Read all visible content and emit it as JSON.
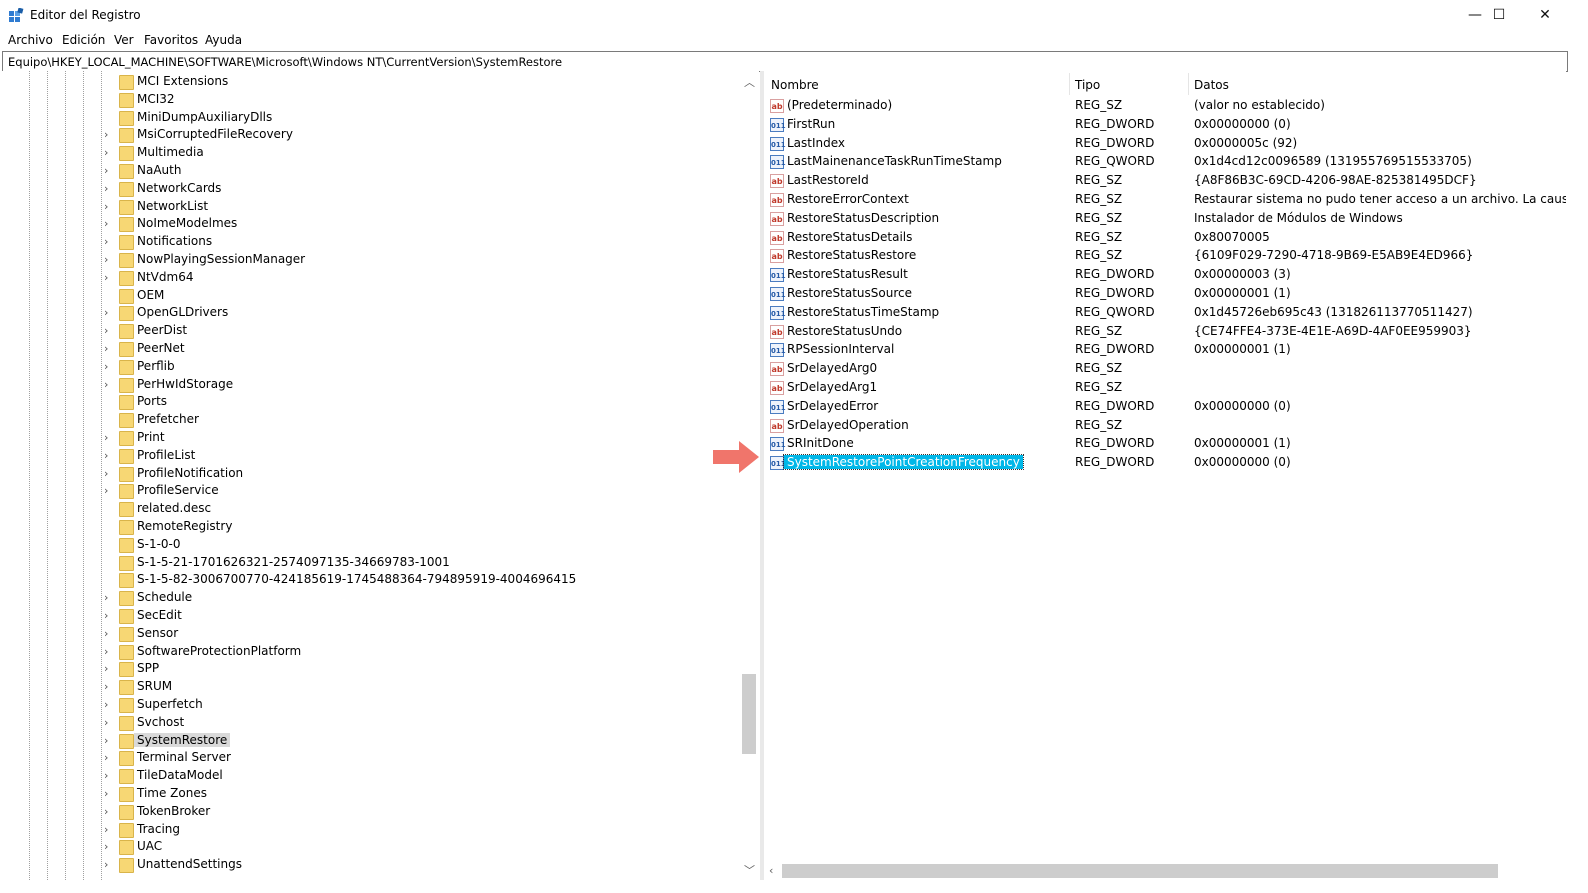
{
  "window": {
    "title": "Editor del Registro",
    "minimize": "—",
    "maximize": "☐",
    "close": "✕"
  },
  "menu": [
    "Archivo",
    "Edición",
    "Ver",
    "Favoritos",
    "Ayuda"
  ],
  "address": "Equipo\\HKEY_LOCAL_MACHINE\\SOFTWARE\\Microsoft\\Windows NT\\CurrentVersion\\SystemRestore",
  "tree": {
    "items": [
      {
        "label": "MCI Extensions",
        "expandable": false
      },
      {
        "label": "MCI32",
        "expandable": false
      },
      {
        "label": "MiniDumpAuxiliaryDlls",
        "expandable": false
      },
      {
        "label": "MsiCorruptedFileRecovery",
        "expandable": true
      },
      {
        "label": "Multimedia",
        "expandable": true
      },
      {
        "label": "NaAuth",
        "expandable": true
      },
      {
        "label": "NetworkCards",
        "expandable": true
      },
      {
        "label": "NetworkList",
        "expandable": true
      },
      {
        "label": "NoImeModelmes",
        "expandable": true
      },
      {
        "label": "Notifications",
        "expandable": true
      },
      {
        "label": "NowPlayingSessionManager",
        "expandable": true
      },
      {
        "label": "NtVdm64",
        "expandable": true
      },
      {
        "label": "OEM",
        "expandable": false
      },
      {
        "label": "OpenGLDrivers",
        "expandable": true
      },
      {
        "label": "PeerDist",
        "expandable": true
      },
      {
        "label": "PeerNet",
        "expandable": true
      },
      {
        "label": "Perflib",
        "expandable": true
      },
      {
        "label": "PerHwIdStorage",
        "expandable": true
      },
      {
        "label": "Ports",
        "expandable": false
      },
      {
        "label": "Prefetcher",
        "expandable": false
      },
      {
        "label": "Print",
        "expandable": true
      },
      {
        "label": "ProfileList",
        "expandable": true
      },
      {
        "label": "ProfileNotification",
        "expandable": true
      },
      {
        "label": "ProfileService",
        "expandable": true
      },
      {
        "label": "related.desc",
        "expandable": false
      },
      {
        "label": "RemoteRegistry",
        "expandable": false
      },
      {
        "label": "S-1-0-0",
        "expandable": false
      },
      {
        "label": "S-1-5-21-1701626321-2574097135-34669783-1001",
        "expandable": false
      },
      {
        "label": "S-1-5-82-3006700770-424185619-1745488364-794895919-4004696415",
        "expandable": false
      },
      {
        "label": "Schedule",
        "expandable": true
      },
      {
        "label": "SecEdit",
        "expandable": true
      },
      {
        "label": "Sensor",
        "expandable": true
      },
      {
        "label": "SoftwareProtectionPlatform",
        "expandable": true
      },
      {
        "label": "SPP",
        "expandable": true
      },
      {
        "label": "SRUM",
        "expandable": true
      },
      {
        "label": "Superfetch",
        "expandable": true
      },
      {
        "label": "Svchost",
        "expandable": true
      },
      {
        "label": "SystemRestore",
        "expandable": true,
        "selected": true
      },
      {
        "label": "Terminal Server",
        "expandable": true
      },
      {
        "label": "TileDataModel",
        "expandable": true
      },
      {
        "label": "Time Zones",
        "expandable": true
      },
      {
        "label": "TokenBroker",
        "expandable": true
      },
      {
        "label": "Tracing",
        "expandable": true
      },
      {
        "label": "UAC",
        "expandable": true
      },
      {
        "label": "UnattendSettings",
        "expandable": true
      }
    ]
  },
  "columns": {
    "name": "Nombre",
    "type": "Tipo",
    "data": "Datos"
  },
  "values": [
    {
      "kind": "sz",
      "name": "(Predeterminado)",
      "type": "REG_SZ",
      "data": "(valor no establecido)"
    },
    {
      "kind": "dw",
      "name": "FirstRun",
      "type": "REG_DWORD",
      "data": "0x00000000 (0)"
    },
    {
      "kind": "dw",
      "name": "LastIndex",
      "type": "REG_DWORD",
      "data": "0x0000005c (92)"
    },
    {
      "kind": "dw",
      "name": "LastMainenanceTaskRunTimeStamp",
      "type": "REG_QWORD",
      "data": "0x1d4cd12c0096589 (131955769515533705)"
    },
    {
      "kind": "sz",
      "name": "LastRestoreId",
      "type": "REG_SZ",
      "data": "{A8F86B3C-69CD-4206-98AE-825381495DCF}"
    },
    {
      "kind": "sz",
      "name": "RestoreErrorContext",
      "type": "REG_SZ",
      "data": "Restaurar sistema no pudo tener acceso a un archivo. La causa más pro"
    },
    {
      "kind": "sz",
      "name": "RestoreStatusDescription",
      "type": "REG_SZ",
      "data": "Instalador de Módulos de Windows"
    },
    {
      "kind": "sz",
      "name": "RestoreStatusDetails",
      "type": "REG_SZ",
      "data": "0x80070005"
    },
    {
      "kind": "sz",
      "name": "RestoreStatusRestore",
      "type": "REG_SZ",
      "data": "{6109F029-7290-4718-9B69-E5AB9E4ED966}"
    },
    {
      "kind": "dw",
      "name": "RestoreStatusResult",
      "type": "REG_DWORD",
      "data": "0x00000003 (3)"
    },
    {
      "kind": "dw",
      "name": "RestoreStatusSource",
      "type": "REG_DWORD",
      "data": "0x00000001 (1)"
    },
    {
      "kind": "dw",
      "name": "RestoreStatusTimeStamp",
      "type": "REG_QWORD",
      "data": "0x1d45726eb695c43 (131826113770511427)"
    },
    {
      "kind": "sz",
      "name": "RestoreStatusUndo",
      "type": "REG_SZ",
      "data": "{CE74FFE4-373E-4E1E-A69D-4AF0EE959903}"
    },
    {
      "kind": "dw",
      "name": "RPSessionInterval",
      "type": "REG_DWORD",
      "data": "0x00000001 (1)"
    },
    {
      "kind": "sz",
      "name": "SrDelayedArg0",
      "type": "REG_SZ",
      "data": ""
    },
    {
      "kind": "sz",
      "name": "SrDelayedArg1",
      "type": "REG_SZ",
      "data": ""
    },
    {
      "kind": "dw",
      "name": "SrDelayedError",
      "type": "REG_DWORD",
      "data": "0x00000000 (0)"
    },
    {
      "kind": "sz",
      "name": "SrDelayedOperation",
      "type": "REG_SZ",
      "data": ""
    },
    {
      "kind": "dw",
      "name": "SRInitDone",
      "type": "REG_DWORD",
      "data": "0x00000001 (1)"
    },
    {
      "kind": "dw",
      "name": "SystemRestorePointCreationFrequency",
      "type": "REG_DWORD",
      "data": "0x00000000 (0)",
      "selected": true
    }
  ],
  "icons": {
    "sz": "ab",
    "dw": "011"
  },
  "colors": {
    "selection": "#00b7e8",
    "tree_selection": "#d9d9d9",
    "arrow": "#f0756b",
    "folder": "#f7d774"
  }
}
